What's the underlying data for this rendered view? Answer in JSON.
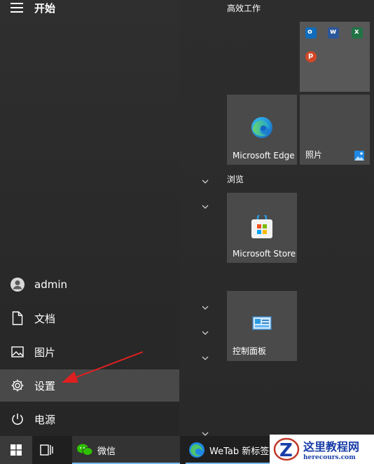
{
  "start": {
    "title": "开始"
  },
  "menu": [
    {
      "key": "admin",
      "label": "admin",
      "icon": "user-avatar-icon"
    },
    {
      "key": "docs",
      "label": "文档",
      "icon": "document-icon"
    },
    {
      "key": "pics",
      "label": "图片",
      "icon": "picture-icon"
    },
    {
      "key": "settings",
      "label": "设置",
      "icon": "gear-icon"
    },
    {
      "key": "power",
      "label": "电源",
      "icon": "power-icon"
    }
  ],
  "groups": {
    "productivity": "高效工作",
    "browse": "浏览"
  },
  "tiles": {
    "edge": "Microsoft Edge",
    "photos": "照片",
    "store": "Microsoft Store",
    "control_panel": "控制面板"
  },
  "taskbar": {
    "wechat": "微信",
    "wetab": "WeTab 新标签页"
  },
  "watermark": {
    "title": "这里教程网",
    "url": "herecours.com"
  },
  "colors": {
    "accent": "#76b9ed",
    "arrow": "#e02020"
  }
}
